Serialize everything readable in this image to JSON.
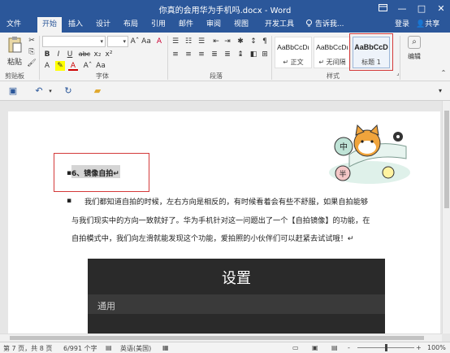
{
  "window": {
    "title": "你真的会用华为手机吗.docx - Word",
    "restore_icon": "restore-icon",
    "min_label": "—",
    "max_label": "□",
    "close_label": "✕"
  },
  "tabs": [
    "文件",
    "开始",
    "插入",
    "设计",
    "布局",
    "引用",
    "邮件",
    "审阅",
    "视图",
    "开发工具"
  ],
  "active_tab_index": 1,
  "tell_me": "告诉我...",
  "login": "登录",
  "share": "共享",
  "ribbon": {
    "paste_label": "粘贴",
    "clipboard_label": "剪贴板",
    "font_label": "字体",
    "paragraph_label": "段落",
    "styles_label": "样式",
    "editing_label": "编辑",
    "styles": [
      {
        "sample": "AaBbCcDı",
        "name": "↵ 正文"
      },
      {
        "sample": "AaBbCcDı",
        "name": "↵ 无间隔"
      },
      {
        "sample": "AaBbCcD",
        "name": "标题 1"
      }
    ],
    "font_letters": {
      "bold": "B",
      "italic": "I",
      "underline": "U",
      "strike": "abc",
      "sub": "x₂",
      "sup": "x²",
      "font_color": "A",
      "size_up": "Aˆ",
      "clear": "Aa"
    }
  },
  "document": {
    "heading": "6、镜像自拍↵",
    "lines": [
      "我们都知道自拍的时候，左右方向是相反的，有时候看着会有些不舒服，如果自拍能够",
      "与我们现实中的方向一致就好了。华为手机针对这一问题出了一个【自拍镜像】的功能，在",
      "自拍模式中，我们向左滑就能发现这个功能，爱拍照的小伙伴们可以赶紧去试试哦！↵"
    ],
    "mascot_labels": [
      "中",
      "半"
    ],
    "phone_title": "设置",
    "phone_section": "通用"
  },
  "status": {
    "page": "第 7 页，共 8 页",
    "words": "6/991 个字",
    "lang": "英语(美国)",
    "zoom": "100%",
    "zoom_minus": "-",
    "zoom_plus": "+"
  }
}
